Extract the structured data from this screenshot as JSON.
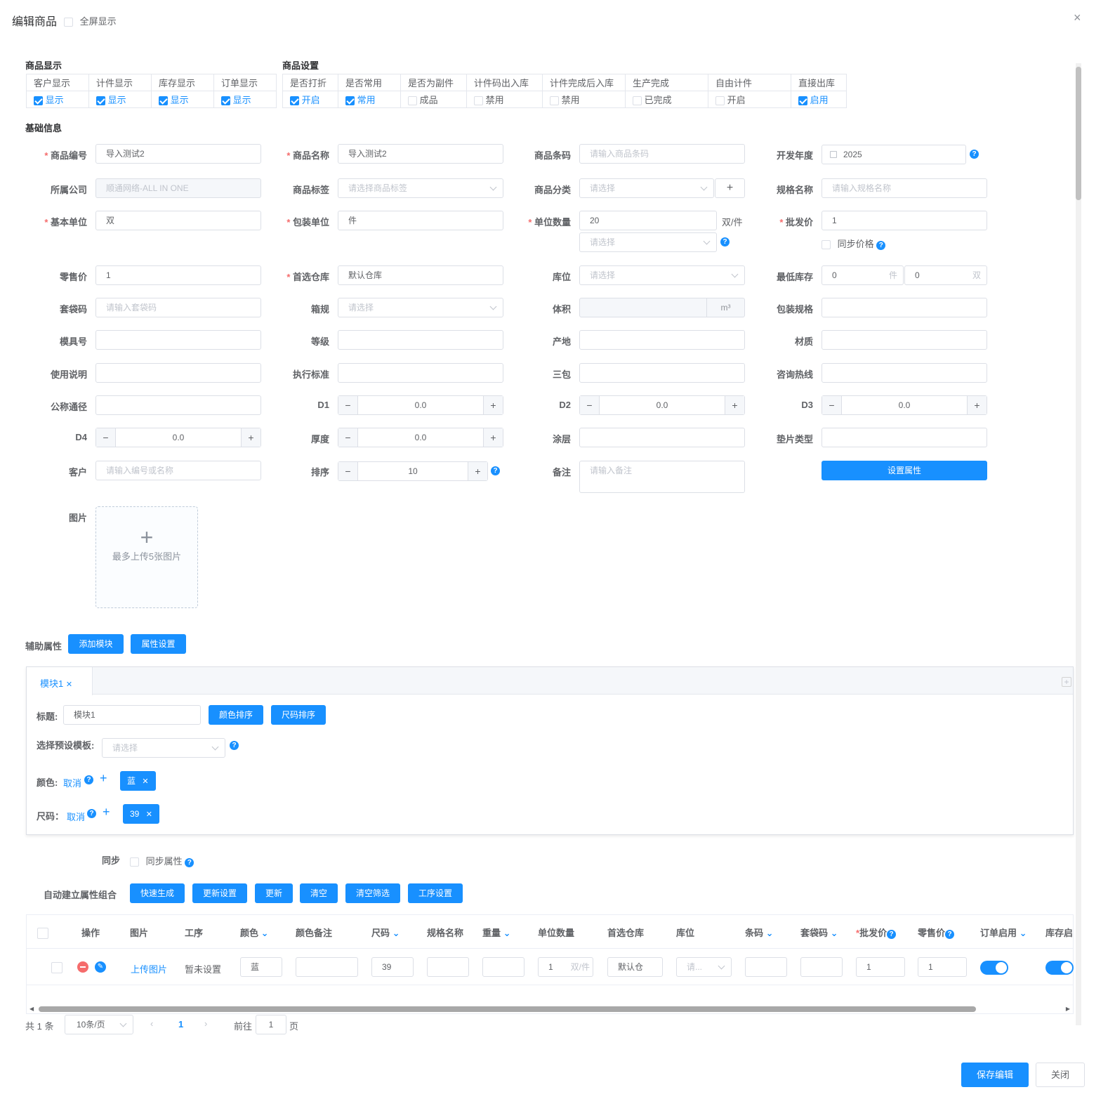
{
  "header": {
    "title": "编辑商品",
    "fullscreen": "全屏显示",
    "close": "×"
  },
  "display": {
    "title": "商品显示",
    "cols": [
      "客户显示",
      "计件显示",
      "库存显示",
      "订单显示"
    ],
    "vals": [
      "显示",
      "显示",
      "显示",
      "显示"
    ]
  },
  "settings": {
    "title": "商品设置",
    "cols": [
      "是否打折",
      "是否常用",
      "是否为副件",
      "计件码出入库",
      "计件完成后入库",
      "生产完成",
      "自由计件",
      "直接出库"
    ],
    "vals": [
      "开启",
      "常用",
      "成品",
      "禁用",
      "禁用",
      "已完成",
      "开启",
      "启用"
    ]
  },
  "basic": {
    "title": "基础信息",
    "code": {
      "label": "商品编号",
      "value": "导入测试2"
    },
    "name": {
      "label": "商品名称",
      "value": "导入测试2"
    },
    "barcode": {
      "label": "商品条码",
      "placeholder": "请输入商品条码"
    },
    "year": {
      "label": "开发年度",
      "value": "2025"
    },
    "company": {
      "label": "所属公司",
      "value": "顺通网络-ALL IN ONE"
    },
    "tag": {
      "label": "商品标签",
      "placeholder": "请选择商品标签"
    },
    "category": {
      "label": "商品分类",
      "placeholder": "请选择",
      "add": "+"
    },
    "spec": {
      "label": "规格名称",
      "placeholder": "请输入规格名称"
    },
    "unit": {
      "label": "基本单位",
      "value": "双"
    },
    "pack": {
      "label": "包装单位",
      "value": "件"
    },
    "qty": {
      "label": "单位数量",
      "value": "20",
      "suffix": "双/件",
      "select": "请选择"
    },
    "wholesale": {
      "label": "批发价",
      "value": "1",
      "sync": "同步价格"
    },
    "retail": {
      "label": "零售价",
      "value": "1"
    },
    "warehouse": {
      "label": "首选仓库",
      "value": "默认仓库"
    },
    "location": {
      "label": "库位",
      "placeholder": "请选择"
    },
    "minstock": {
      "label": "最低库存",
      "v1": "0",
      "u1": "件",
      "v2": "0",
      "u2": "双"
    },
    "bagcode": {
      "label": "套袋码",
      "placeholder": "请输入套袋码"
    },
    "box": {
      "label": "箱规",
      "placeholder": "请选择"
    },
    "volume": {
      "label": "体积",
      "unit": "m³"
    },
    "packspec": {
      "label": "包装规格"
    },
    "mold": {
      "label": "模具号"
    },
    "grade": {
      "label": "等级"
    },
    "origin": {
      "label": "产地"
    },
    "material": {
      "label": "材质"
    },
    "usage": {
      "label": "使用说明"
    },
    "standard": {
      "label": "执行标准"
    },
    "warranty": {
      "label": "三包"
    },
    "hotline": {
      "label": "咨询热线"
    },
    "dn": {
      "label": "公称通径"
    },
    "d1": {
      "label": "D1",
      "value": "0.0"
    },
    "d2": {
      "label": "D2",
      "value": "0.0"
    },
    "d3": {
      "label": "D3",
      "value": "0.0"
    },
    "d4": {
      "label": "D4",
      "value": "0.0"
    },
    "thick": {
      "label": "厚度",
      "value": "0.0"
    },
    "coating": {
      "label": "涂层"
    },
    "gasket": {
      "label": "垫片类型"
    },
    "customer": {
      "label": "客户",
      "placeholder": "请输入编号或名称"
    },
    "sort": {
      "label": "排序",
      "value": "10"
    },
    "remark": {
      "label": "备注",
      "placeholder": "请输入备注"
    },
    "setattr": "设置属性",
    "image": {
      "label": "图片",
      "hint": "最多上传5张图片"
    }
  },
  "aux": {
    "title": "辅助属性",
    "add": "添加模块",
    "attrset": "属性设置",
    "tab": "模块1",
    "titleLabel": "标题:",
    "titleValue": "模块1",
    "colorSort": "颜色排序",
    "sizeSort": "尺码排序",
    "preset": "选择预设模板:",
    "presetPh": "请选择",
    "colorLabel": "颜色:",
    "sizeLabel": "尺码：",
    "cancel": "取消",
    "color": "蓝",
    "size": "39"
  },
  "sync": {
    "label": "同步",
    "text": "同步属性"
  },
  "auto": {
    "label": "自动建立属性组合",
    "btns": [
      "快速生成",
      "更新设置",
      "更新",
      "清空",
      "清空筛选",
      "工序设置"
    ]
  },
  "table": {
    "cols": [
      "操作",
      "图片",
      "工序",
      "颜色",
      "颜色备注",
      "尺码",
      "规格名称",
      "重量",
      "单位数量",
      "首选仓库",
      "库位",
      "条码",
      "套袋码",
      "批发价",
      "零售价",
      "订单启用",
      "库存启"
    ],
    "row": {
      "upload": "上传图片",
      "process": "暂未设置",
      "color": "蓝",
      "size": "39",
      "qty": "1",
      "qtyUnit": "双/件",
      "wh": "默认仓",
      "loc": "请...",
      "wholesale": "1",
      "retail": "1"
    }
  },
  "pager": {
    "total": "共 1 条",
    "size": "10条/页",
    "page": "1",
    "goto": "前往",
    "pageInput": "1",
    "pageUnit": "页"
  },
  "footer": {
    "save": "保存编辑",
    "close": "关闭"
  }
}
